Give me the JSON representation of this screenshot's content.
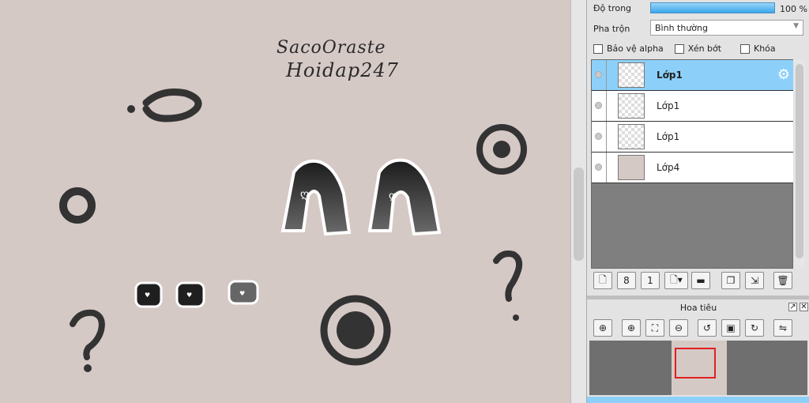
{
  "canvas": {
    "watermark_line1": "SacoOraste",
    "watermark_line2": "Hoidap247",
    "background": "#d5c9c6"
  },
  "layer_properties": {
    "opacity_label": "Độ trong",
    "opacity_value": "100 %",
    "blend_label": "Pha trộn",
    "blend_value": "Bình thường",
    "checks": [
      "Bảo vệ alpha",
      "Xén bớt",
      "Khóa"
    ]
  },
  "layers": [
    {
      "name": "Lớp1",
      "selected": true
    },
    {
      "name": "Lớp1",
      "selected": false
    },
    {
      "name": "Lớp1",
      "selected": false
    },
    {
      "name": "Lớp4",
      "selected": false
    }
  ],
  "layer_toolbar": [
    "new-layer-icon",
    "layer-8-icon",
    "layer-1-icon",
    "add-dropdown-icon",
    "folder-icon",
    "duplicate-icon",
    "merge-icon",
    "trash-icon"
  ],
  "navigator": {
    "title": "Hoa tiêu",
    "tools": [
      "zoom-reset-icon",
      "zoom-in-icon",
      "fit-icon",
      "zoom-out-icon",
      "rotate-left-icon",
      "fit-window-icon",
      "rotate-right-icon",
      "flip-icon"
    ]
  },
  "colors": {
    "accent": "#8cd0fa",
    "nav_rect": "#e0201f"
  }
}
